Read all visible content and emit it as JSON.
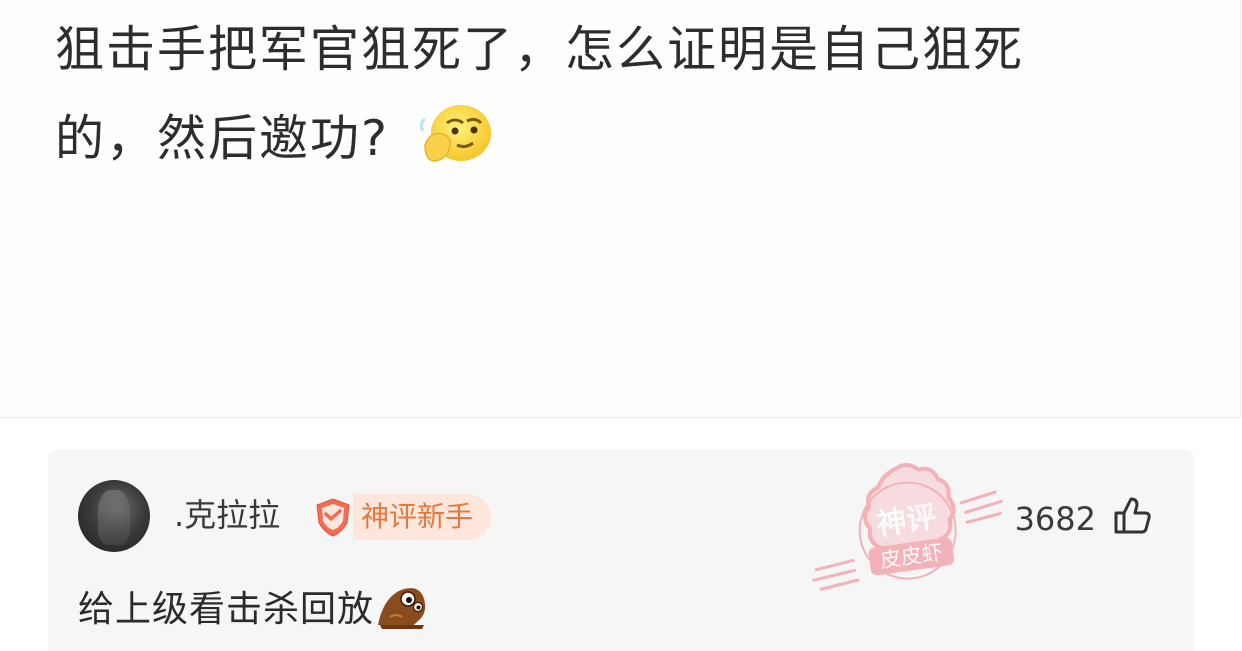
{
  "post": {
    "line1": "狙击手把军官狙死了，怎么证明是自己狙死",
    "line2": "的，然后邀功?",
    "emoji": "thinking-face-icon"
  },
  "comment": {
    "username": ".克拉拉",
    "badge_label": "神评新手",
    "like_count": "3682",
    "text": "给上级看击杀回放",
    "emoji": "bird-emoji-icon"
  },
  "watermark": {
    "top": "神评",
    "bottom": "皮皮虾"
  },
  "colors": {
    "badge_text": "#e2793f",
    "badge_bg": "#fde7dc",
    "watermark": "#f07b86",
    "comment_bg": "#f6f6f6"
  }
}
